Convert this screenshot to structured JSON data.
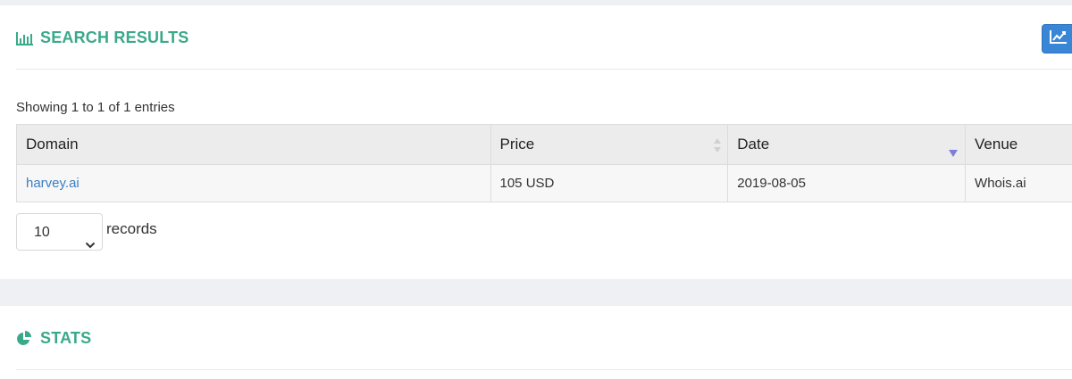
{
  "results_panel": {
    "title": "SEARCH RESULTS",
    "title_icon": "bar-chart-icon",
    "chart_button_icon": "line-chart-icon"
  },
  "table": {
    "info": "Showing 1 to 1 of 1 entries",
    "columns": [
      {
        "label": "Domain",
        "sort": "none"
      },
      {
        "label": "Price",
        "sort": "both"
      },
      {
        "label": "Date",
        "sort": "desc"
      },
      {
        "label": "Venue",
        "sort": "none"
      }
    ],
    "rows": [
      {
        "domain": "harvey.ai",
        "price": "105 USD",
        "date": "2019-08-05",
        "venue": "Whois.ai"
      }
    ]
  },
  "length_menu": {
    "value": "10",
    "label": "records"
  },
  "stats_panel": {
    "title": "STATS",
    "title_icon": "pie-chart-icon"
  },
  "colors": {
    "accent": "#3aa98a",
    "button": "#3a86d6",
    "link": "#3a7fc2",
    "sort_active": "#7b7fd6"
  }
}
